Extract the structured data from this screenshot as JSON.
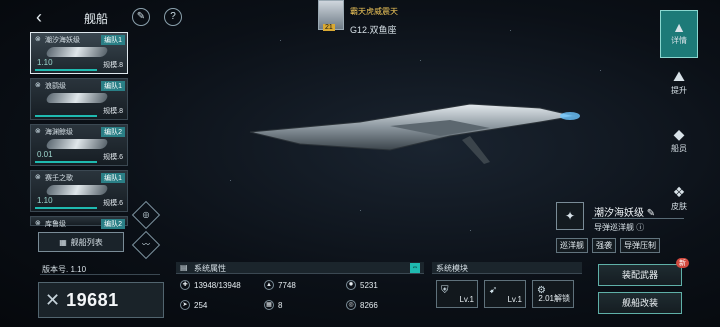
{
  "header": {
    "back_icon": "chevron-left-icon",
    "title": "舰船",
    "tool_icon_1": "wrench-icon",
    "tool_icon_2": "help-icon"
  },
  "player": {
    "name": "霸天虎威震天",
    "level": "21",
    "rank": "G12.双鱼座"
  },
  "ship_list": [
    {
      "name": "潮汐海妖级",
      "fleet": "编队1",
      "version": "1.10",
      "scale": "规模.8",
      "selected": true
    },
    {
      "name": "浪鹞级",
      "fleet": "编队1",
      "version": "",
      "scale": "规模.8",
      "selected": false
    },
    {
      "name": "海渊鲸级",
      "fleet": "编队2",
      "version": "0.01",
      "scale": "规模.6",
      "selected": false
    },
    {
      "name": "赛壬之歌",
      "fleet": "编队1",
      "version": "1.10",
      "scale": "规模.6",
      "selected": false
    },
    {
      "name": "库鲁级",
      "fleet": "编队2",
      "version": "",
      "scale": "",
      "selected": false
    }
  ],
  "ship_list_button": "舰船列表",
  "version_label": "版本号. 1.10",
  "power": "19681",
  "right_tabs": [
    {
      "label": "详情",
      "icon": "details-icon",
      "active": true
    },
    {
      "label": "提升",
      "icon": "upgrade-icon",
      "active": false
    },
    {
      "label": "船员",
      "icon": "crew-icon",
      "active": false
    },
    {
      "label": "皮肤",
      "icon": "skin-icon",
      "active": false
    }
  ],
  "ship_info": {
    "name": "潮汐海妖级",
    "type": "导弹巡洋舰",
    "tags": [
      "巡洋舰",
      "强袭",
      "导弹压制"
    ]
  },
  "attributes": {
    "header": "系统属性",
    "items": [
      {
        "icon": "hp-icon",
        "value": "13948/13948"
      },
      {
        "icon": "cargo-icon",
        "value": "7748"
      },
      {
        "icon": "armor-icon",
        "value": "5231"
      },
      {
        "icon": "speed-icon",
        "value": "254"
      },
      {
        "icon": "grid-icon",
        "value": "8"
      },
      {
        "icon": "target-icon",
        "value": "8266"
      }
    ]
  },
  "modules": {
    "header": "系统模块",
    "items": [
      {
        "icon": "shield-icon",
        "level": "Lv.1"
      },
      {
        "icon": "missile-icon",
        "level": "Lv.1"
      },
      {
        "icon": "locked-module-icon",
        "level": "2.01解锁"
      }
    ]
  },
  "buttons": {
    "equip": "装配武器",
    "refit": "舰船改装",
    "new_badge": "新"
  }
}
